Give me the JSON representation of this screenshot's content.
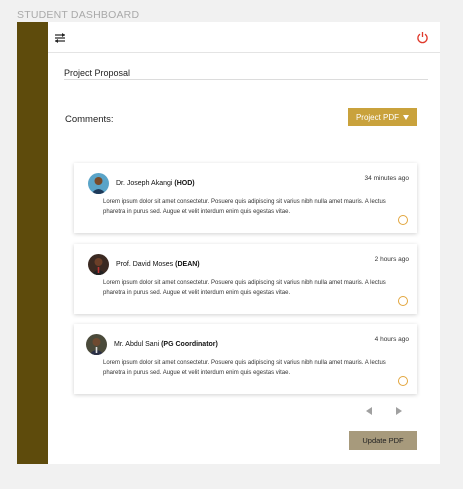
{
  "app": {
    "title": "STUDENT DASHBOARD"
  },
  "colors": {
    "sidebar": "#5e4b0c",
    "accent": "#c9a23c",
    "update_button": "#a79a7c",
    "power": "#e0392b",
    "status_ring": "#e2a63e"
  },
  "icons": {
    "menu": "menu-toggle-icon",
    "power": "power-icon",
    "prev": "chevron-left-icon",
    "next": "chevron-right-icon"
  },
  "page": {
    "title": "Project Proposal",
    "comments_label": "Comments:"
  },
  "pdf_button": {
    "label": "Project PDF"
  },
  "comments": [
    {
      "name": "Dr. Joseph Akangi",
      "role": "(HOD)",
      "time": "34 minutes ago",
      "text": "Lorem ipsum dolor sit amet consectetur. Posuere quis adipiscing sit varius nibh nulla amet mauris. A lectus pharetra in purus sed. Augue et velit interdum enim quis egestas vitae."
    },
    {
      "name": "Prof. David Moses",
      "role": "(DEAN)",
      "time": "2 hours ago",
      "text": "Lorem ipsum dolor sit amet consectetur. Posuere quis adipiscing sit varius nibh nulla amet mauris. A lectus pharetra in purus sed. Augue et velit interdum enim quis egestas vitae."
    },
    {
      "name": "Mr. Abdul Sani",
      "role": "(PG Coordinator)",
      "time": "4 hours ago",
      "text": "Lorem ipsum dolor sit amet consectetur. Posuere quis adipiscing sit varius nibh nulla amet mauris. A lectus pharetra in purus sed. Augue et velit interdum enim quis egestas vitae."
    }
  ],
  "update_button": {
    "label": "Update PDF"
  }
}
